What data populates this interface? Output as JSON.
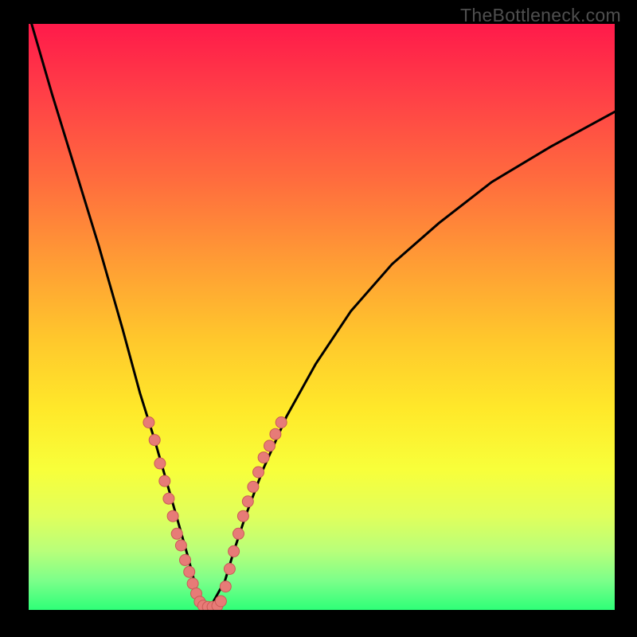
{
  "watermark": "TheBottleneck.com",
  "chart_data": {
    "type": "line",
    "title": "",
    "xlabel": "",
    "ylabel": "",
    "xlim": [
      0,
      100
    ],
    "ylim": [
      0,
      100
    ],
    "background_gradient_stops": [
      {
        "pct": 0,
        "color": "#ff1a4a"
      },
      {
        "pct": 12,
        "color": "#ff3f47"
      },
      {
        "pct": 26,
        "color": "#ff6a3e"
      },
      {
        "pct": 40,
        "color": "#ff9a35"
      },
      {
        "pct": 54,
        "color": "#ffc82c"
      },
      {
        "pct": 66,
        "color": "#ffe92a"
      },
      {
        "pct": 76,
        "color": "#f8ff3a"
      },
      {
        "pct": 84,
        "color": "#e0ff5c"
      },
      {
        "pct": 90,
        "color": "#b8ff7a"
      },
      {
        "pct": 95,
        "color": "#7cff8a"
      },
      {
        "pct": 100,
        "color": "#2eff78"
      }
    ],
    "series": [
      {
        "name": "bottleneck-curve",
        "x": [
          0.5,
          4,
          8,
          12,
          16,
          19,
          21.5,
          23.5,
          25.5,
          27.2,
          28.5,
          29.6,
          31.0,
          33.5,
          35,
          37,
          40,
          44,
          49,
          55,
          62,
          70,
          79,
          89,
          100
        ],
        "y": [
          100,
          88,
          75,
          62,
          48,
          37,
          29,
          22,
          15,
          9,
          4,
          0.5,
          0.5,
          5,
          10,
          16,
          24,
          33,
          42,
          51,
          59,
          66,
          73,
          79,
          85
        ]
      }
    ],
    "scatter": [
      {
        "name": "left-branch-dots",
        "points": [
          {
            "x": 20.5,
            "y": 32
          },
          {
            "x": 21.5,
            "y": 29
          },
          {
            "x": 22.4,
            "y": 25
          },
          {
            "x": 23.2,
            "y": 22
          },
          {
            "x": 23.9,
            "y": 19
          },
          {
            "x": 24.6,
            "y": 16
          },
          {
            "x": 25.3,
            "y": 13
          },
          {
            "x": 26.0,
            "y": 11
          },
          {
            "x": 26.7,
            "y": 8.5
          },
          {
            "x": 27.4,
            "y": 6.5
          },
          {
            "x": 28.0,
            "y": 4.5
          },
          {
            "x": 28.6,
            "y": 2.8
          },
          {
            "x": 29.2,
            "y": 1.4
          }
        ]
      },
      {
        "name": "valley-dots",
        "points": [
          {
            "x": 29.8,
            "y": 0.7
          },
          {
            "x": 30.6,
            "y": 0.5
          },
          {
            "x": 31.4,
            "y": 0.5
          },
          {
            "x": 32.2,
            "y": 0.7
          },
          {
            "x": 32.8,
            "y": 1.5
          }
        ]
      },
      {
        "name": "right-branch-dots",
        "points": [
          {
            "x": 33.6,
            "y": 4
          },
          {
            "x": 34.3,
            "y": 7
          },
          {
            "x": 35.0,
            "y": 10
          },
          {
            "x": 35.8,
            "y": 13
          },
          {
            "x": 36.6,
            "y": 16
          },
          {
            "x": 37.4,
            "y": 18.5
          },
          {
            "x": 38.3,
            "y": 21
          },
          {
            "x": 39.2,
            "y": 23.5
          },
          {
            "x": 40.1,
            "y": 26
          },
          {
            "x": 41.1,
            "y": 28
          },
          {
            "x": 42.1,
            "y": 30
          },
          {
            "x": 43.1,
            "y": 32
          }
        ]
      }
    ]
  }
}
